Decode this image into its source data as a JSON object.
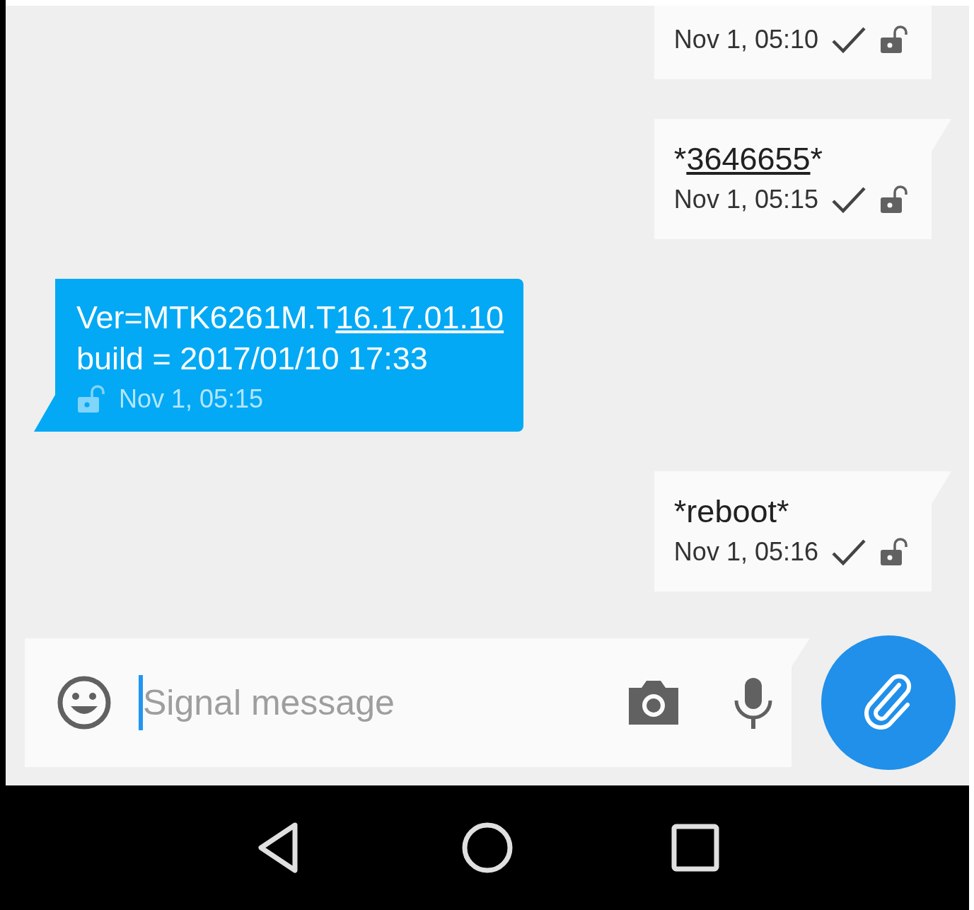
{
  "messages": [
    {
      "kind": "outgoing",
      "time": "Nov 1, 05:10",
      "delivered": true
    },
    {
      "kind": "outgoing",
      "parts": [
        {
          "text": "*",
          "link": false
        },
        {
          "text": "3646655",
          "link": true
        },
        {
          "text": "*",
          "link": false
        }
      ],
      "time": "Nov 1, 05:15",
      "delivered": true
    },
    {
      "kind": "incoming",
      "parts": [
        {
          "text": "Ver=MTK6261M.T",
          "link": false
        },
        {
          "text": "16.17.01.10",
          "link": true
        },
        {
          "text": "\nbuild = 2017/01/10 17:33",
          "link": false
        }
      ],
      "time": "Nov 1, 05:15",
      "delivered": false
    },
    {
      "kind": "outgoing",
      "parts": [
        {
          "text": "*reboot*",
          "link": false
        }
      ],
      "time": "Nov 1, 05:16",
      "delivered": true
    }
  ],
  "composer": {
    "placeholder": "Signal message"
  }
}
